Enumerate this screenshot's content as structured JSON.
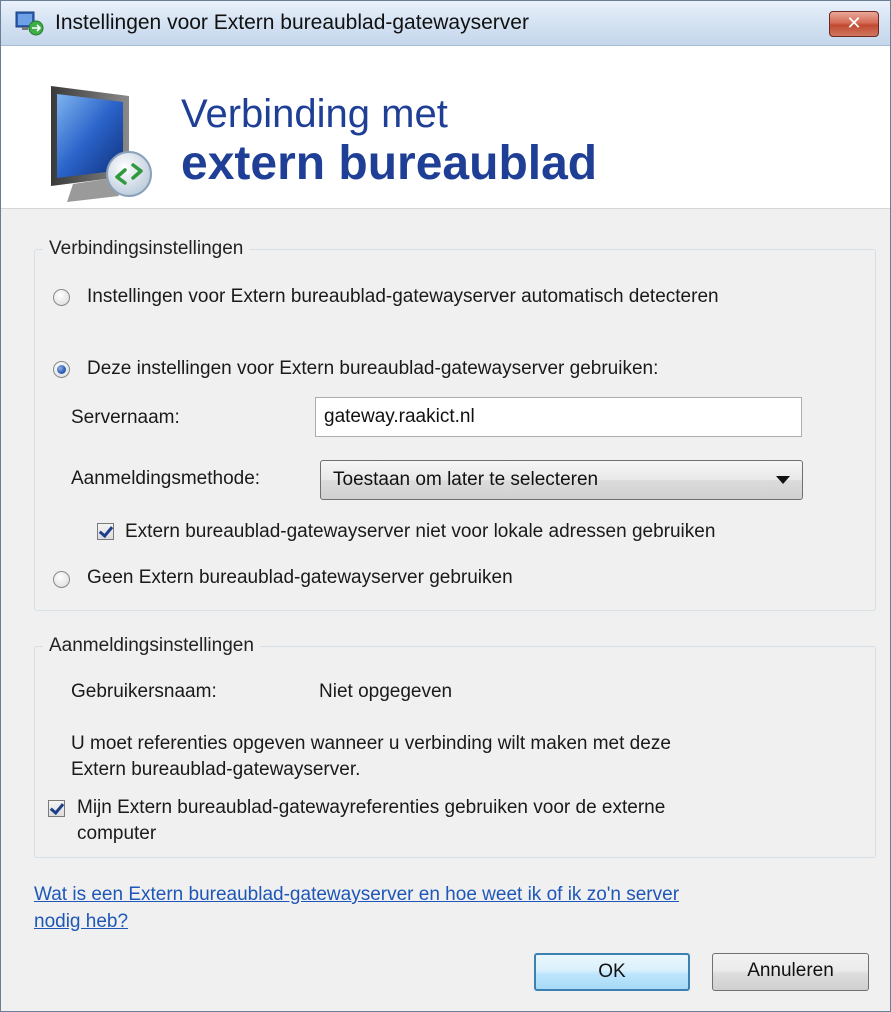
{
  "window": {
    "title": "Instellingen voor Extern bureaublad-gatewayserver",
    "close_label": "✕"
  },
  "banner": {
    "line1": "Verbinding met",
    "line2": "extern bureaublad"
  },
  "connection_settings": {
    "legend": "Verbindingsinstellingen",
    "auto_detect_label": "Instellingen voor Extern bureaublad-gatewayserver automatisch detecteren",
    "use_settings_label": "Deze instellingen voor Extern bureaublad-gatewayserver gebruiken:",
    "server_name_label": "Servernaam:",
    "server_name_value": "gateway.raakict.nl",
    "logon_method_label": "Aanmeldingsmethode:",
    "logon_method_value": "Toestaan om later te selecteren",
    "bypass_local_label": "Extern bureaublad-gatewayserver niet voor lokale adressen gebruiken",
    "no_gateway_label": "Geen Extern bureaublad-gatewayserver gebruiken",
    "selected_option": "use_settings",
    "bypass_local_checked": true
  },
  "logon_settings": {
    "legend": "Aanmeldingsinstellingen",
    "username_label": "Gebruikersnaam:",
    "username_value": "Niet opgegeven",
    "info_line1": "U moet referenties opgeven wanneer u verbinding wilt maken met deze",
    "info_line2": "Extern bureaublad-gatewayserver.",
    "use_credentials_line1": "Mijn Extern bureaublad-gatewayreferenties gebruiken voor de externe",
    "use_credentials_line2": "computer",
    "use_credentials_checked": true
  },
  "help_link": {
    "line1": "Wat is een Extern bureaublad-gatewayserver en hoe weet ik of ik zo'n server",
    "line2": "nodig heb?"
  },
  "buttons": {
    "ok": "OK",
    "cancel": "Annuleren"
  },
  "colors": {
    "banner_text": "#1f3f97",
    "link": "#1e57b7",
    "dialog_bg": "#f0f0f0"
  },
  "icons": {
    "app": "remote-desktop-icon",
    "banner": "monitor-remote-icon"
  }
}
